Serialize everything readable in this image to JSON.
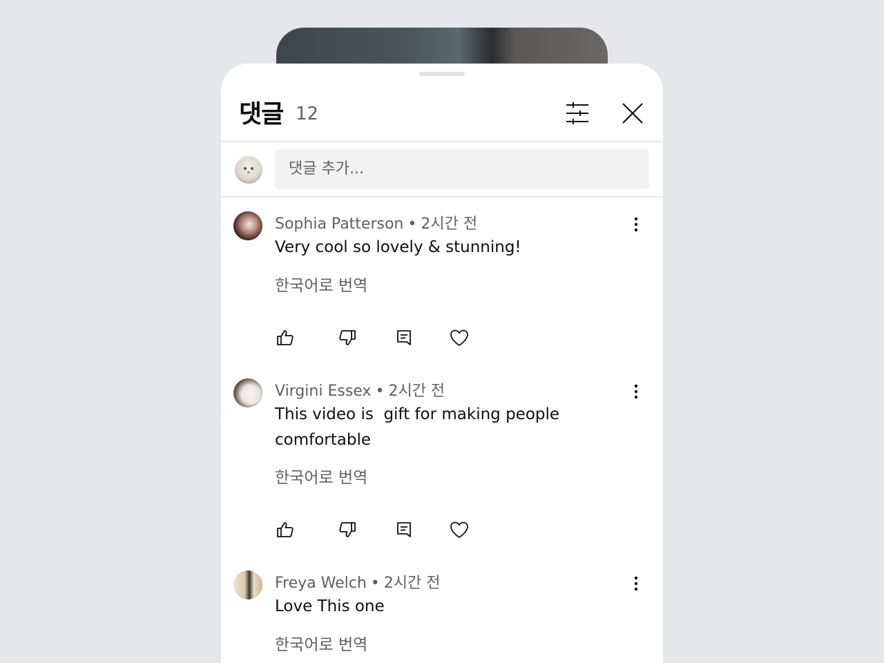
{
  "header": {
    "title": "댓글",
    "count": "12"
  },
  "add_comment": {
    "placeholder": "댓글 추가..."
  },
  "comments": [
    {
      "author": "Sophia Patterson",
      "time": "2시간 전",
      "text": "Very cool so lovely & stunning!",
      "translate": "한국어로 번역"
    },
    {
      "author": "Virgini Essex",
      "time": "2시간 전",
      "text": "This video is  gift for making people comfortable",
      "translate": "한국어로 번역"
    },
    {
      "author": "Freya Welch",
      "time": "2시간 전",
      "text": "Love This one",
      "translate": "한국어로 번역"
    }
  ],
  "meta_separator": "•",
  "icons": {
    "filter": "sliders-icon",
    "close": "close-icon",
    "more": "more-vertical-icon",
    "like": "thumb-up-icon",
    "dislike": "thumb-down-icon",
    "reply": "reply-icon",
    "heart": "heart-icon"
  }
}
